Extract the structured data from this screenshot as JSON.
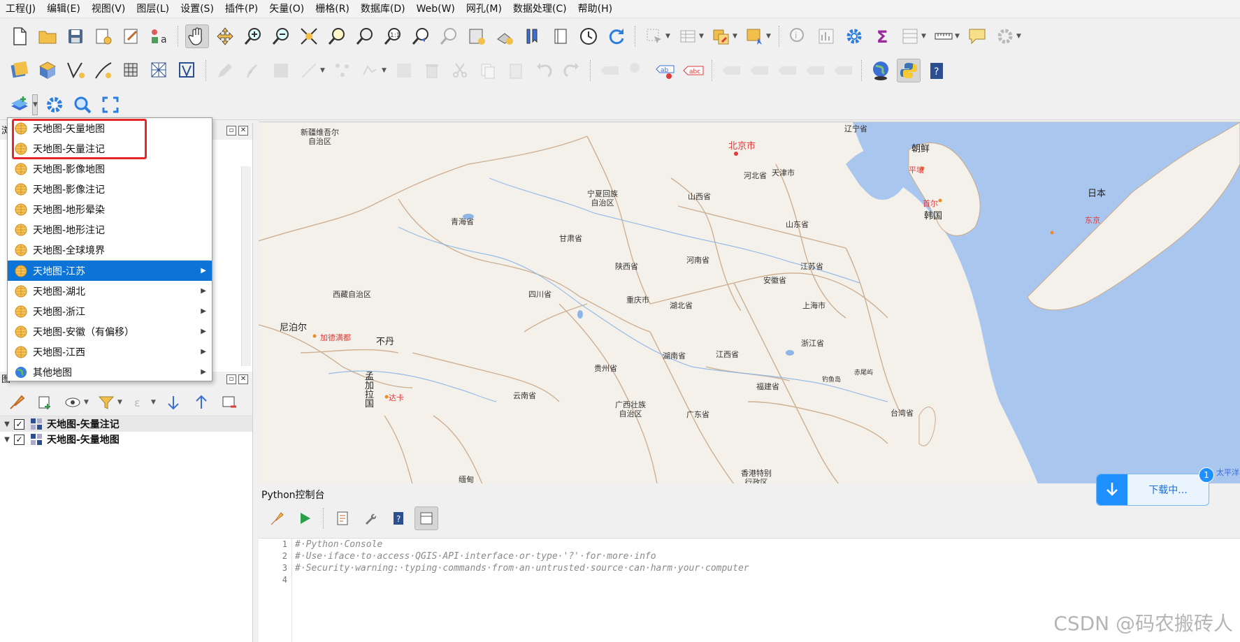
{
  "menubar": {
    "items": [
      "工程(J)",
      "编辑(E)",
      "视图(V)",
      "图层(L)",
      "设置(S)",
      "插件(P)",
      "矢量(O)",
      "栅格(R)",
      "数据库(D)",
      "Web(W)",
      "网孔(M)",
      "数据处理(C)",
      "帮助(H)"
    ]
  },
  "toolbar1": {
    "icons": [
      "new-project-icon",
      "open-project-icon",
      "save-project-icon",
      "project-properties-icon",
      "print-layout-icon",
      "style-manager-icon",
      "pan-hand-icon",
      "pan-to-selection-icon",
      "zoom-in-icon",
      "zoom-out-icon",
      "zoom-full-icon",
      "zoom-to-selection-icon",
      "zoom-to-layer-icon",
      "zoom-native-icon",
      "zoom-last-icon",
      "zoom-next-icon",
      "new-bookmark-icon",
      "show-bookmarks-icon",
      "temporal-controller-icon",
      "refresh-icon",
      "select-features-icon",
      "attribute-table-icon",
      "deselect-icon",
      "select-location-icon",
      "identify-icon",
      "statistics-icon",
      "gear-icon",
      "sigma-icon",
      "field-calculator-icon",
      "measure-icon",
      "map-tips-icon",
      "settings-icon"
    ]
  },
  "toolbar2": {
    "icons": [
      "data-source-manager-icon",
      "new-geopackage-icon",
      "new-shapefile-icon",
      "new-temporary-layer-icon",
      "new-virtual-layer-icon",
      "new-mesh-layer-icon",
      "vertex-tool-icon"
    ]
  },
  "toolbar3": {
    "icons": [
      "add-layer-icon",
      "settings-gear-icon",
      "search-magnifier-icon",
      "fullscreen-extent-icon"
    ]
  },
  "dropdown": {
    "items": [
      {
        "label": "天地图-矢量地图",
        "submenu": false
      },
      {
        "label": "天地图-矢量注记",
        "submenu": false
      },
      {
        "label": "天地图-影像地图",
        "submenu": false
      },
      {
        "label": "天地图-影像注记",
        "submenu": false
      },
      {
        "label": "天地图-地形晕染",
        "submenu": false
      },
      {
        "label": "天地图-地形注记",
        "submenu": false
      },
      {
        "label": "天地图-全球境界",
        "submenu": false
      },
      {
        "label": "天地图-江苏",
        "submenu": true,
        "selected": true
      },
      {
        "label": "天地图-湖北",
        "submenu": true
      },
      {
        "label": "天地图-浙江",
        "submenu": true
      },
      {
        "label": "天地图-安徽（有偏移）",
        "submenu": true
      },
      {
        "label": "天地图-江西",
        "submenu": true
      },
      {
        "label": "其他地图",
        "submenu": true,
        "globe": true
      }
    ],
    "highlight_color": "#e8262a",
    "selected_color": "#0b74d6"
  },
  "browser_panel": {
    "title": "浏"
  },
  "layers_panel": {
    "title": "图",
    "layers": [
      {
        "name": "天地图-矢量注记",
        "checked": true
      },
      {
        "name": "天地图-矢量地图",
        "checked": true
      }
    ]
  },
  "map": {
    "labels": {
      "xinjiang": "新疆维吾尔\n自治区",
      "beijing": "北京市",
      "liaoning": "辽宁省",
      "chaoxian": "朝鲜",
      "pingrang": "平壤",
      "hebei": "河北省",
      "tianjin": "天津市",
      "ningxia": "宁夏回族\n自治区",
      "shanxi": "山西省",
      "shouer": "首尔",
      "hanguo": "韩国",
      "riben": "日本",
      "dongjing": "东京",
      "qinghai": "青海省",
      "shandong": "山东省",
      "gansu": "甘肃省",
      "shaanxi": "陕西省",
      "henan": "河南省",
      "jiangsu": "江苏省",
      "anhui": "安徽省",
      "xizang": "西藏自治区",
      "sichuan": "四川省",
      "chongqing": "重庆市",
      "hubei": "湖北省",
      "shanghai": "上海市",
      "nepal": "尼泊尔",
      "kathmandu": "加德满都",
      "bhutan": "不丹",
      "zhejiang": "浙江省",
      "jiangxi": "江西省",
      "hunan": "湖南省",
      "guizhou": "贵州省",
      "chiweiyu": "赤尾屿",
      "diaoyudao": "钓鱼岛",
      "bangla": "孟\n加\n拉\n国",
      "dhaka": "达卡",
      "yunnan": "云南省",
      "fujian": "福建省",
      "guangxi": "广西壮族\n自治区",
      "guangdong": "广东省",
      "taiwan": "台湾省",
      "myanmar": "缅甸",
      "hongkong": "香港特别\n行政区",
      "pacific": "太平洋"
    },
    "colors": {
      "land": "#f4f1ea",
      "sea": "#a9c6ee",
      "border": "#c9a98a"
    }
  },
  "python_console": {
    "title": "Python控制台",
    "tools": [
      "clear-console-icon",
      "run-command-icon",
      "show-editor-icon",
      "options-wrench-icon",
      "help-icon",
      "toggle-editor-icon"
    ],
    "line_numbers": [
      "1",
      "2",
      "3",
      "4"
    ],
    "lines": [
      "#·Python·Console",
      "#·Use·iface·to·access·QGIS·API·interface·or·type·'?'·for·more·info",
      "#·Security·warning:·typing·commands·from·an·untrusted·source·can·harm·your·computer",
      ""
    ]
  },
  "download_widget": {
    "label": "下载中...",
    "badge": "1"
  },
  "watermark": "CSDN @码农搬砖人"
}
